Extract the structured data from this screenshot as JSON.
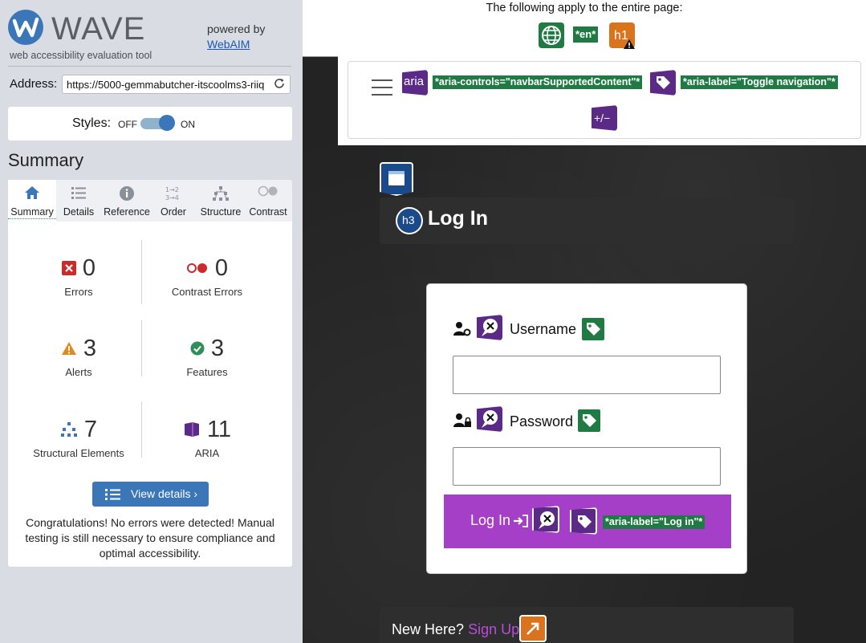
{
  "wave": {
    "logo_letter": "W",
    "title": "WAVE",
    "tagline": "web accessibility evaluation tool",
    "powered_by": "powered by",
    "webaim": "WebAIM",
    "address_label": "Address:",
    "address_value": "https://5000-gemmabutcher-itscoolms3-riiq",
    "styles_label": "Styles:",
    "styles_off": "OFF",
    "styles_on": "ON",
    "styles_state": "on",
    "summary_title": "Summary",
    "tabs": [
      {
        "label": "Summary",
        "icon": "home-icon",
        "active": true
      },
      {
        "label": "Details",
        "icon": "list-icon",
        "active": false
      },
      {
        "label": "Reference",
        "icon": "info-icon",
        "active": false
      },
      {
        "label": "Order",
        "icon": "order-icon",
        "active": false
      },
      {
        "label": "Structure",
        "icon": "structure-icon",
        "active": false
      },
      {
        "label": "Contrast",
        "icon": "contrast-icon",
        "active": false
      }
    ],
    "stats": {
      "errors": {
        "count": "0",
        "label": "Errors"
      },
      "contrast_errors": {
        "count": "0",
        "label": "Contrast Errors"
      },
      "alerts": {
        "count": "3",
        "label": "Alerts"
      },
      "features": {
        "count": "3",
        "label": "Features"
      },
      "structural": {
        "count": "7",
        "label": "Structural Elements"
      },
      "aria": {
        "count": "11",
        "label": "ARIA"
      }
    },
    "view_details": "View details ›",
    "congrats": "Congratulations! No errors were detected! Manual testing is still necessary to ensure compliance and optimal accessibility."
  },
  "page": {
    "apply_text": "The following apply to the entire page:",
    "lang_tag": "*en*",
    "h1_badge": "h1",
    "aria_badge": "aria",
    "aria_controls": "*aria-controls=\"navbarSupportedContent\"*",
    "aria_label_toggle": "*aria-label=\"Toggle navigation\"*",
    "expand_badge": "+/−",
    "h3_badge": "h3",
    "heading": "Log In",
    "username_label": "Username",
    "password_label": "Password",
    "login_button": "Log In",
    "aria_label_login": "*aria-label=\"Log in\"*",
    "new_here": "New Here?",
    "sign_up": "Sign Up"
  },
  "colors": {
    "wave_blue": "#3a76b8",
    "aria_purple": "#5b2a86",
    "feature_green": "#1f7a44",
    "alert_orange": "#d9731e",
    "login_purple": "#a53fc8"
  }
}
